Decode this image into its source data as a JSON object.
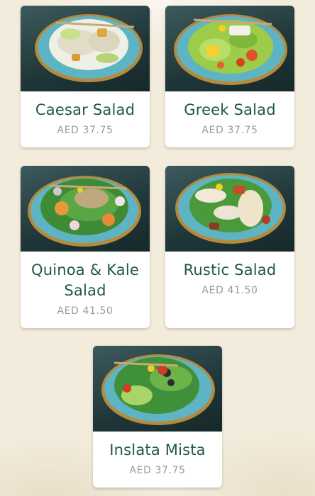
{
  "menu_items": [
    {
      "name": "Caesar Salad",
      "price": "AED 37.75"
    },
    {
      "name": "Greek Salad",
      "price": "AED 37.75"
    },
    {
      "name": "Quinoa & Kale Salad",
      "price": "AED 41.50"
    },
    {
      "name": "Rustic Salad",
      "price": "AED 41.50"
    },
    {
      "name": "Inslata Mista",
      "price": "AED 37.75"
    }
  ],
  "colors": {
    "background": "#f3ecdc",
    "title": "#1f5a3c",
    "price": "#9a9a9a",
    "plate": "#5fb4c4"
  },
  "icons": [
    "salad-photo"
  ]
}
